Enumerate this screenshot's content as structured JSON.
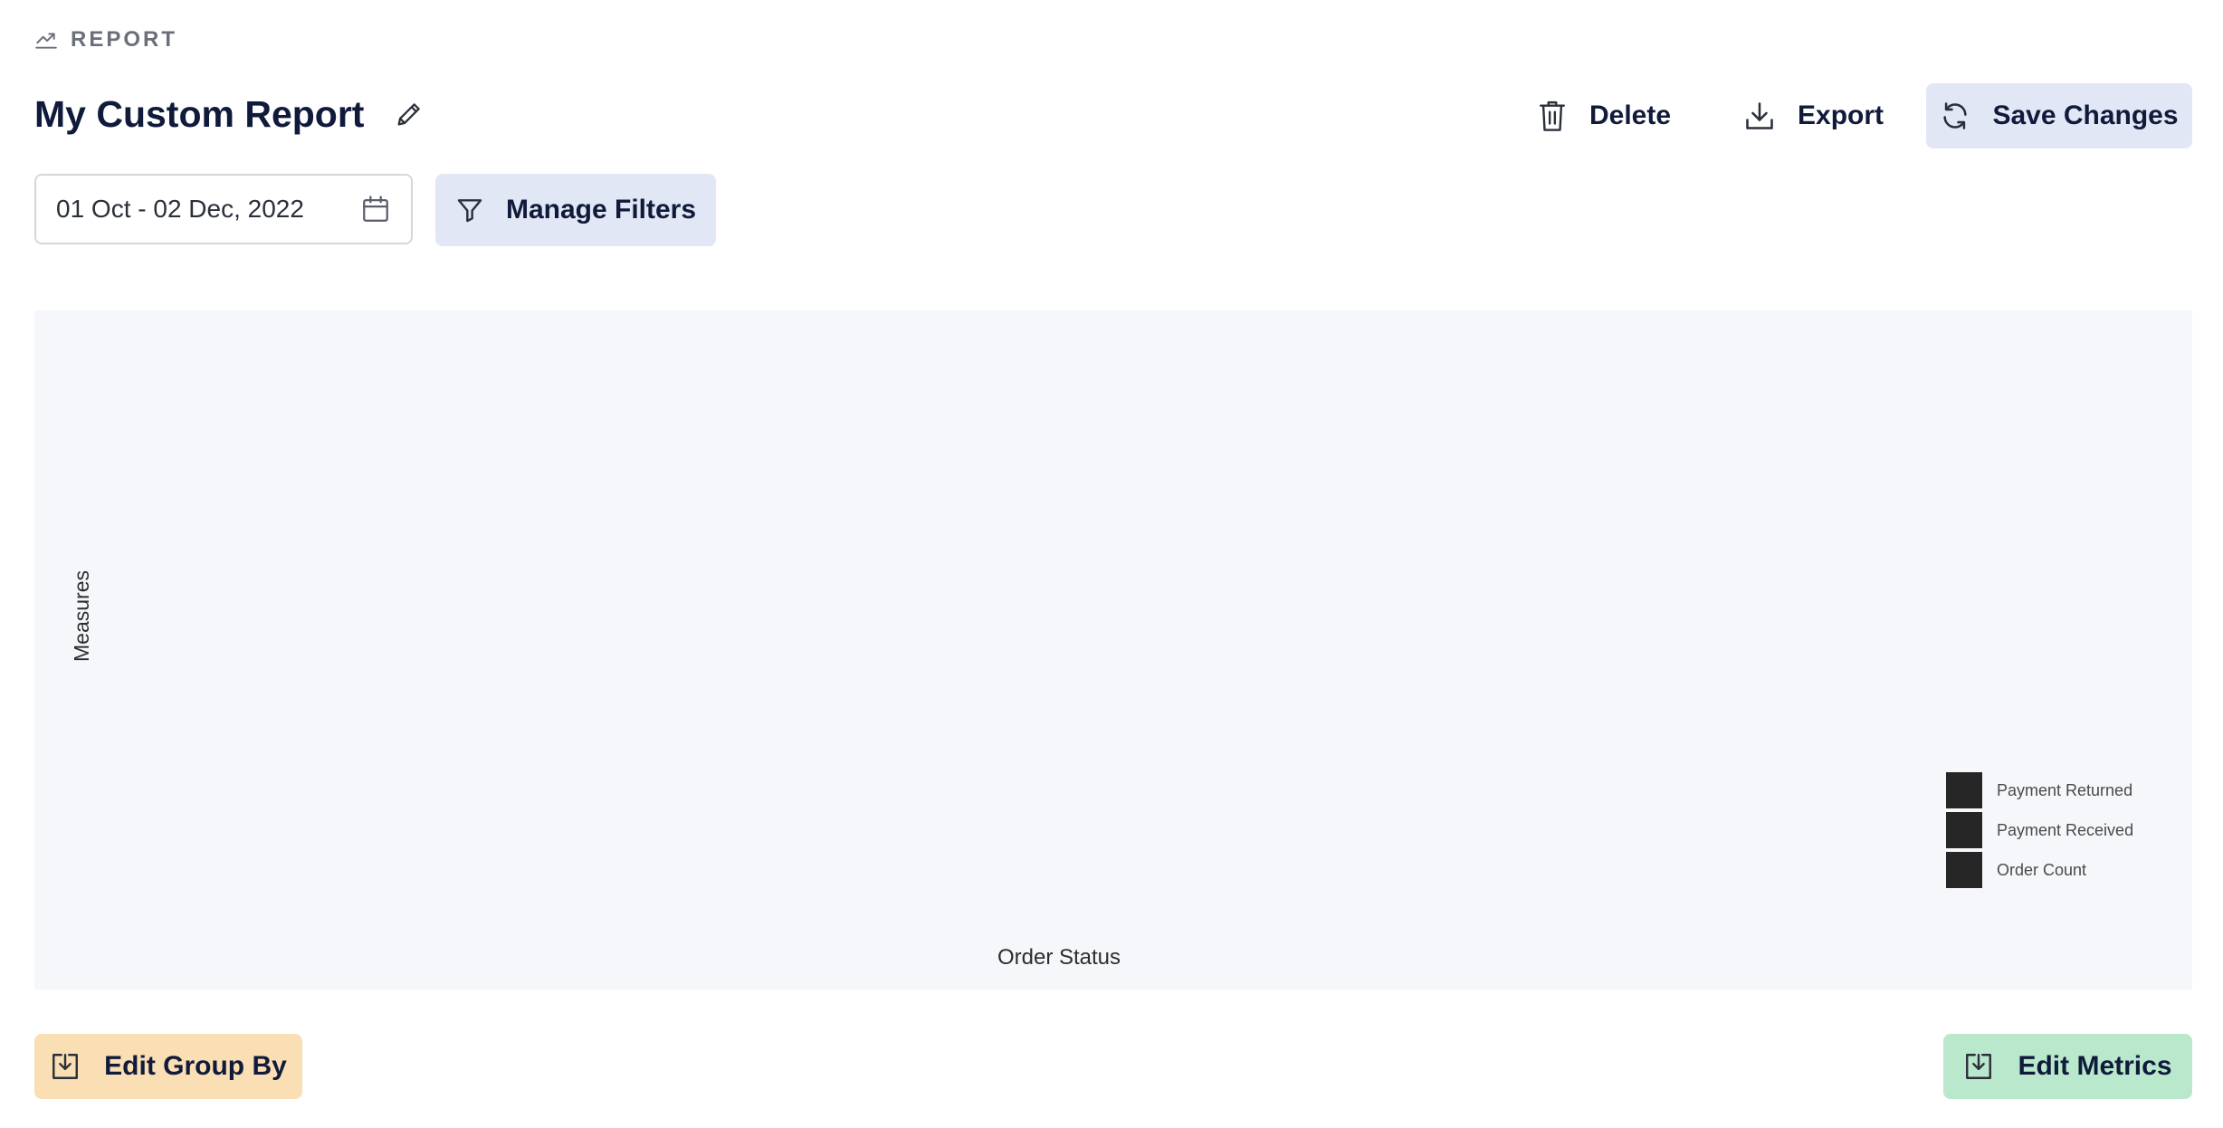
{
  "header": {
    "eyebrow_label": "REPORT",
    "eyebrow_icon": "trending-up-icon",
    "title": "My Custom Report",
    "edit_icon": "pencil-icon"
  },
  "actions": {
    "delete_label": "Delete",
    "export_label": "Export",
    "save_label": "Save Changes"
  },
  "controls": {
    "date_range_value": "01 Oct - 02 Dec, 2022",
    "manage_filters_label": "Manage Filters"
  },
  "chart_data": {
    "type": "bar",
    "title": "",
    "xlabel": "Order Status",
    "ylabel": "Measures",
    "categories": [],
    "series": [
      {
        "name": "Payment Returned",
        "values": []
      },
      {
        "name": "Payment Received",
        "values": []
      },
      {
        "name": "Order Count",
        "values": []
      }
    ],
    "legend_position": "right",
    "legend_swatch_color": "#262626",
    "background_color": "#f5f7fb"
  },
  "footer": {
    "edit_group_by_label": "Edit Group By",
    "edit_metrics_label": "Edit Metrics"
  },
  "colors": {
    "primary_text": "#101a3b",
    "save_button_bg": "#e1e7f4",
    "group_by_button_bg": "#fbdfb4",
    "metrics_button_bg": "#b9e8cc"
  }
}
